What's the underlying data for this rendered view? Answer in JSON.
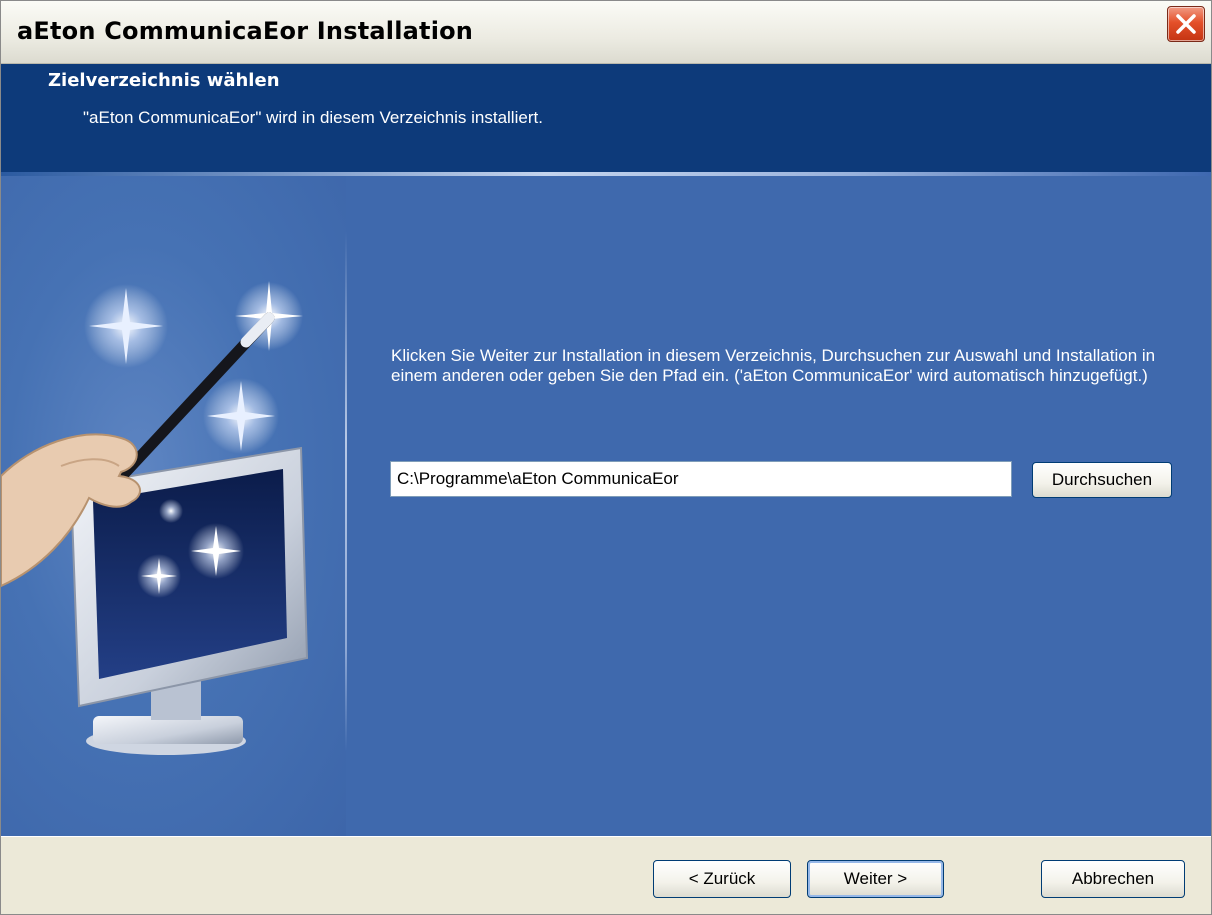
{
  "window": {
    "title": "aEton CommunicaEor Installation"
  },
  "header": {
    "title": "Zielverzeichnis wählen",
    "subtitle": "\"aEton CommunicaEor\" wird in diesem Verzeichnis installiert."
  },
  "content": {
    "instruction": "Klicken Sie Weiter zur Installation in diesem Verzeichnis, Durchsuchen zur Auswahl und Installation in einem anderen oder geben Sie den Pfad ein. ('aEton CommunicaEor' wird automatisch hinzugefügt.)",
    "path_value": "C:\\Programme\\aEton CommunicaEor",
    "browse_label": "Durchsuchen"
  },
  "footer": {
    "back_label": "< Zurück",
    "next_label": "Weiter >",
    "cancel_label": "Abbrechen"
  },
  "icons": {
    "close": "close-icon",
    "wizard": "magic-wand-monitor-illustration"
  },
  "colors": {
    "header_bg": "#0d3a7a",
    "content_bg": "#3f69ad",
    "close_button": "#e4502a"
  }
}
